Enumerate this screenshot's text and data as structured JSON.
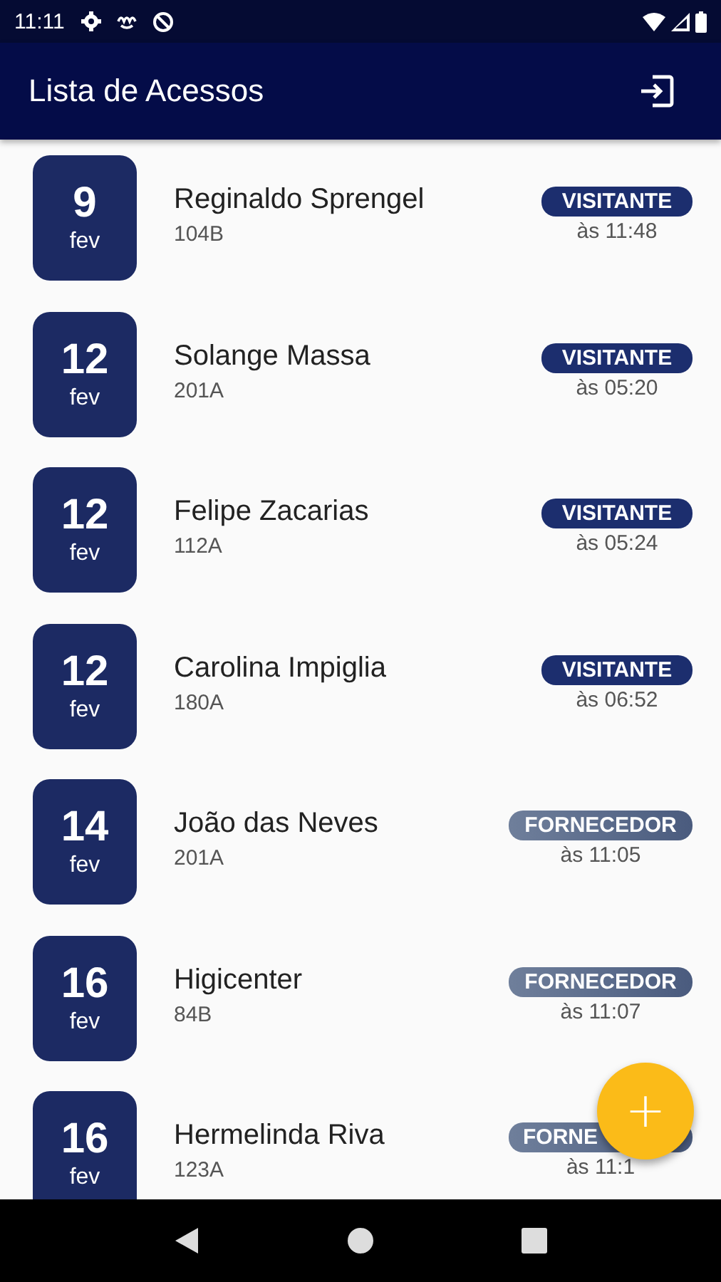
{
  "status_bar": {
    "time": "11:11"
  },
  "app_bar": {
    "title": "Lista de Acessos"
  },
  "accesses": [
    {
      "day": "9",
      "month": "fev",
      "name": "Reginaldo Sprengel",
      "unit": "104B",
      "kind": "visitor",
      "badge": "VISITANTE",
      "time": "às 11:48"
    },
    {
      "day": "12",
      "month": "fev",
      "name": "Solange Massa",
      "unit": "201A",
      "kind": "visitor",
      "badge": "VISITANTE",
      "time": "às 05:20"
    },
    {
      "day": "12",
      "month": "fev",
      "name": "Felipe Zacarias",
      "unit": "112A",
      "kind": "visitor",
      "badge": "VISITANTE",
      "time": "às 05:24"
    },
    {
      "day": "12",
      "month": "fev",
      "name": "Carolina Impiglia",
      "unit": "180A",
      "kind": "visitor",
      "badge": "VISITANTE",
      "time": "às 06:52"
    },
    {
      "day": "14",
      "month": "fev",
      "name": "João das Neves",
      "unit": "201A",
      "kind": "supplier",
      "badge": "FORNECEDOR",
      "time": "às 11:05"
    },
    {
      "day": "16",
      "month": "fev",
      "name": "Higicenter",
      "unit": "84B",
      "kind": "supplier",
      "badge": "FORNECEDOR",
      "time": "às 11:07"
    },
    {
      "day": "16",
      "month": "fev",
      "name": "Hermelinda Riva",
      "unit": "123A",
      "kind": "supplier",
      "badge": "FORNE",
      "time": "às 11:1"
    }
  ],
  "fab": {
    "label": "+"
  }
}
